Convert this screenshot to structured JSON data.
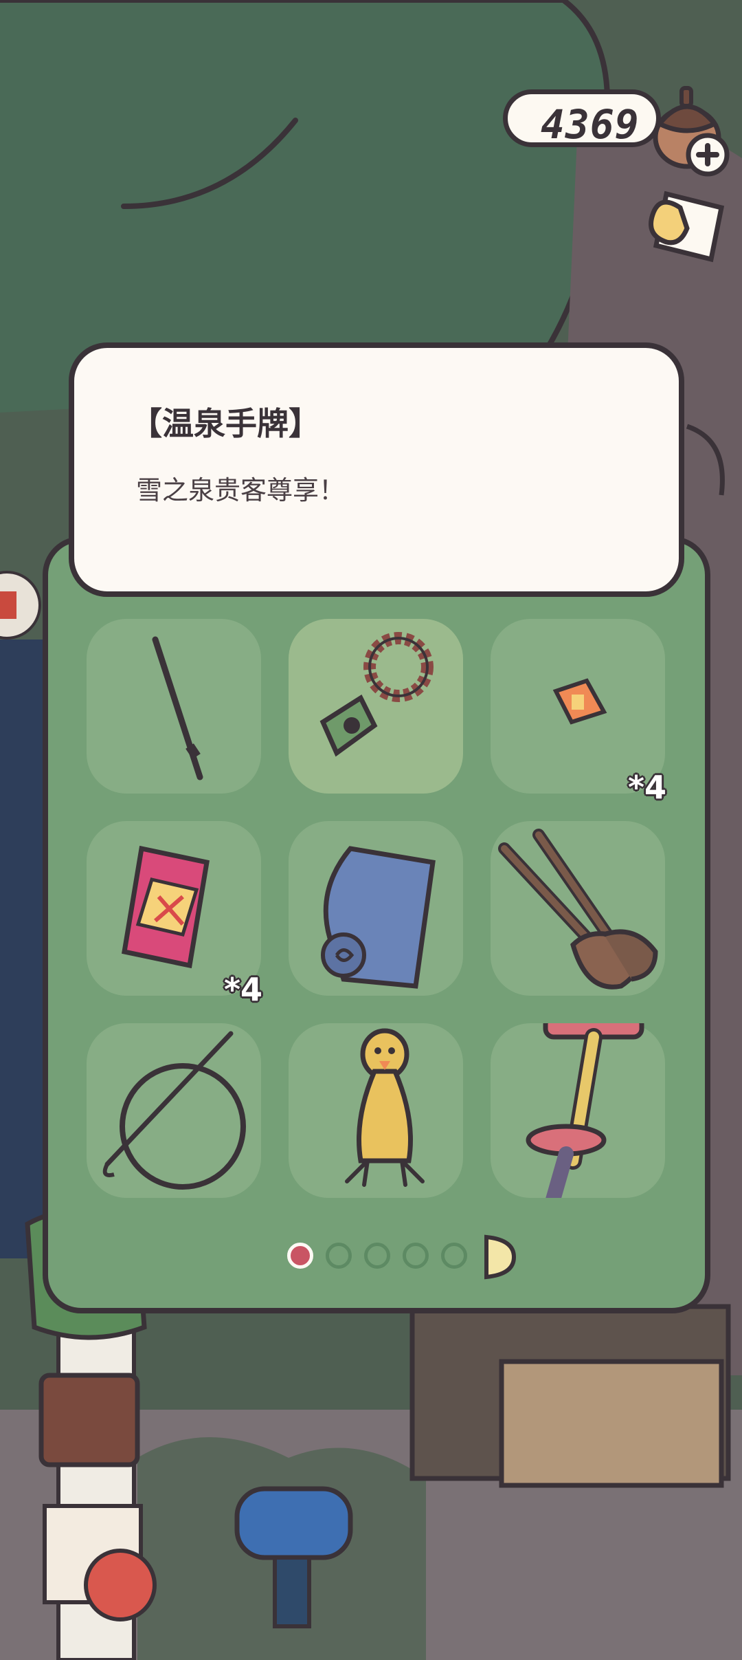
{
  "currency": {
    "amount": "4369",
    "icon": "acorn-icon",
    "add_icon": "plus-icon"
  },
  "top_right": {
    "icon": "ticket-icon"
  },
  "item_detail": {
    "title": "【温泉手牌】",
    "description": "雪之泉贵客尊享！"
  },
  "inventory": {
    "items": [
      {
        "icon": "fishing-rod-stick-icon",
        "count": "",
        "selected": false
      },
      {
        "icon": "onsen-tag-bead-icon",
        "count": "",
        "selected": true
      },
      {
        "icon": "ticket-small-icon",
        "count": "*4",
        "selected": false
      },
      {
        "icon": "firework-box-icon",
        "count": "*4",
        "selected": false
      },
      {
        "icon": "blue-mat-icon",
        "count": "",
        "selected": false
      },
      {
        "icon": "wooden-paddles-icon",
        "count": "",
        "selected": false
      },
      {
        "icon": "hoop-and-stick-icon",
        "count": "",
        "selected": false
      },
      {
        "icon": "rubber-duck-toy-icon",
        "count": "",
        "selected": false
      },
      {
        "icon": "pogo-stick-icon",
        "count": "",
        "selected": false
      }
    ],
    "page_count": 5,
    "current_page": 1
  },
  "colors": {
    "panel": "#75a077",
    "slot": "#87ad85",
    "outline": "#3a3238",
    "card": "#fdf9f4",
    "active_dot": "#c95564"
  }
}
